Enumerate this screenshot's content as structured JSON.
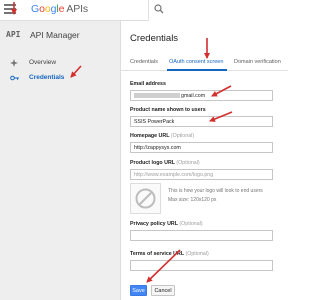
{
  "header": {
    "logo_parts": [
      "G",
      "o",
      "o",
      "g",
      "l",
      "e"
    ],
    "logo_suffix": "APIs",
    "search_icon": "search-icon",
    "menu_icon": "hamburger-menu-icon"
  },
  "sidebar": {
    "api_abbr": "API",
    "title": "API Manager",
    "items": [
      {
        "label": "Overview",
        "icon": "overview-icon",
        "active": false
      },
      {
        "label": "Credentials",
        "icon": "key-icon",
        "active": true
      }
    ]
  },
  "main": {
    "title": "Credentials",
    "tabs": [
      {
        "label": "Credentials",
        "active": false
      },
      {
        "label": "OAuth consent screen",
        "active": true
      },
      {
        "label": "Domain verification",
        "active": false
      }
    ],
    "fields": {
      "email": {
        "label": "Email address",
        "value": "gmail.com"
      },
      "product_name": {
        "label": "Product name shown to users",
        "value": "SSIS PowerPack"
      },
      "homepage": {
        "label": "Homepage URL",
        "optional": "(Optional)",
        "value": "http://zappysys.com"
      },
      "logo_url": {
        "label": "Product logo URL",
        "optional": "(Optional)",
        "placeholder": "http://www.example.com/logo.png"
      },
      "privacy": {
        "label": "Privacy policy URL",
        "optional": "(Optional)",
        "placeholder": ""
      },
      "terms": {
        "label": "Terms of service URL",
        "optional": "(Optional)",
        "placeholder": ""
      }
    },
    "logo_hint_line1": "This is how your logo will look to end users",
    "logo_hint_line2": "Max size: 120x120 px",
    "save_label": "Save",
    "cancel_label": "Cancel"
  },
  "colors": {
    "accent": "#1565c0",
    "primary_button": "#4285f4",
    "annotation_arrow": "#d32f2f"
  }
}
